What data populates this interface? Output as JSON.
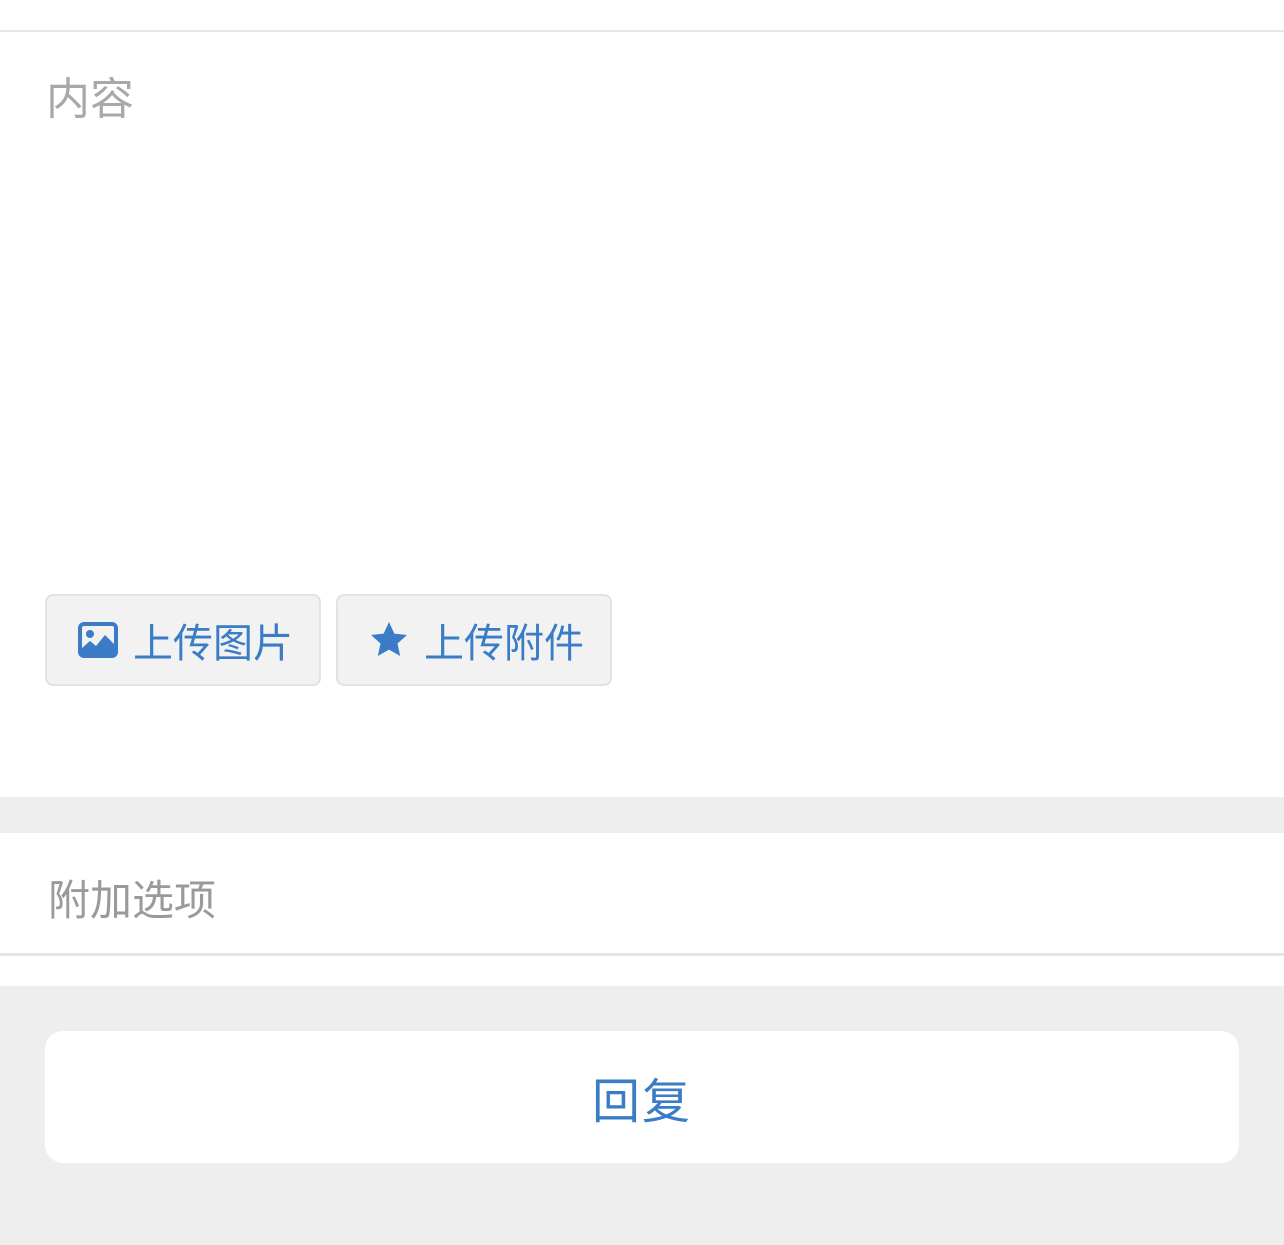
{
  "editor": {
    "content_placeholder": "内容",
    "content_value": ""
  },
  "uploads": {
    "image_label": "上传图片",
    "image_icon": "image-icon",
    "attachment_label": "上传附件",
    "attachment_icon": "star-icon"
  },
  "options": {
    "label": "附加选项"
  },
  "actions": {
    "reply_label": "回复"
  },
  "colors": {
    "accent": "#3a7cc6",
    "placeholder": "#a8a8a8",
    "background": "#eeeeee"
  }
}
